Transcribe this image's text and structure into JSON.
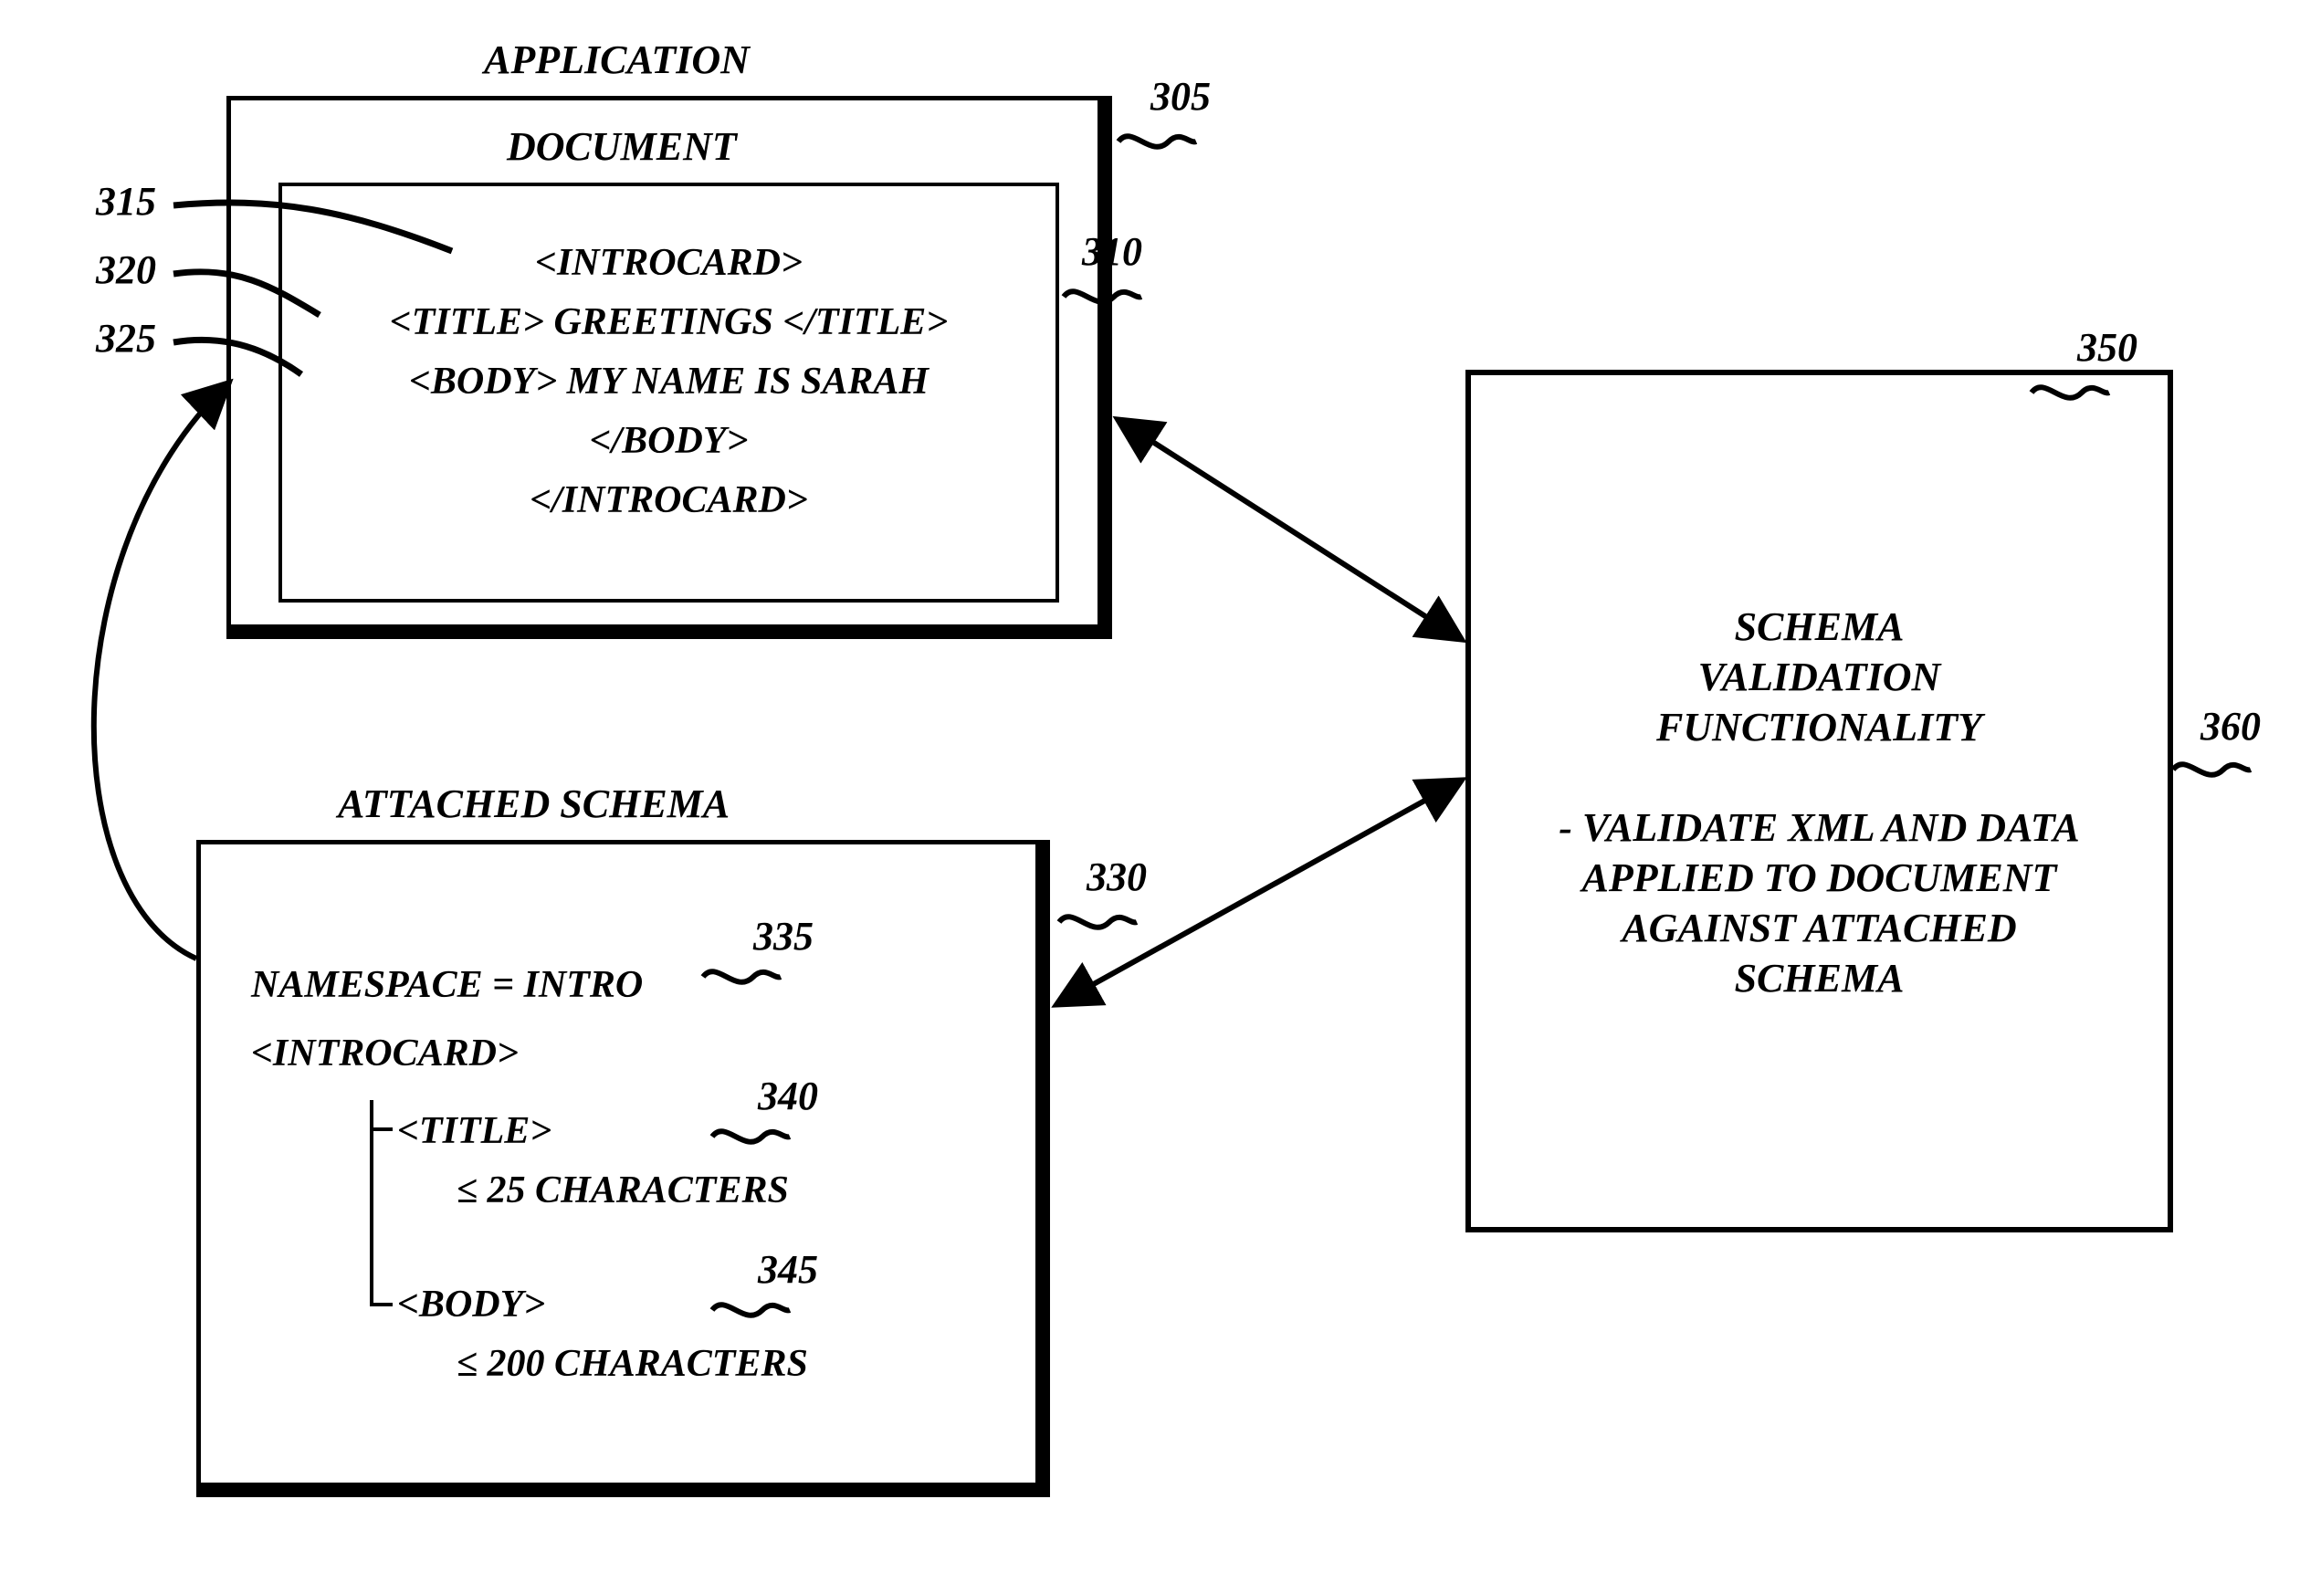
{
  "titles": {
    "application": "APPLICATION",
    "document": "DOCUMENT",
    "attached_schema": "ATTACHED SCHEMA"
  },
  "refs": {
    "r305": "305",
    "r310": "310",
    "r315": "315",
    "r320": "320",
    "r325": "325",
    "r330": "330",
    "r335": "335",
    "r340": "340",
    "r345": "345",
    "r350": "350",
    "r360": "360"
  },
  "document_lines": {
    "l1": "<INTROCARD>",
    "l2": "<TITLE> GREETINGS </TITLE>",
    "l3": "<BODY> MY NAME IS SARAH",
    "l4": "</BODY>",
    "l5": "</INTROCARD>"
  },
  "schema_lines": {
    "namespace": "NAMESPACE = INTRO",
    "introcard": "<INTROCARD>",
    "title_tag": "<TITLE>",
    "title_rule": "≤  25 CHARACTERS",
    "body_tag": "<BODY>",
    "body_rule": "≤  200 CHARACTERS"
  },
  "validation": {
    "heading_l1": "SCHEMA",
    "heading_l2": "VALIDATION",
    "heading_l3": "FUNCTIONALITY",
    "desc_l1": "- VALIDATE XML AND DATA",
    "desc_l2": "APPLIED TO DOCUMENT",
    "desc_l3": "AGAINST ATTACHED",
    "desc_l4": "SCHEMA"
  }
}
